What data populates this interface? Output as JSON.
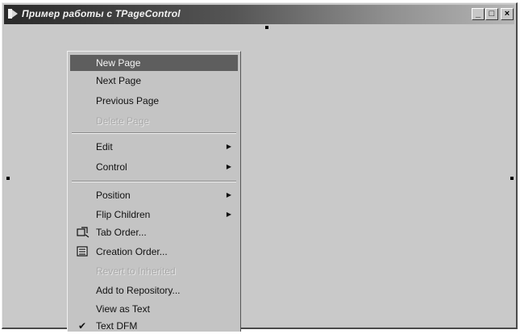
{
  "window": {
    "title": "Пример работы с TPageControl",
    "min_symbol": "_",
    "max_symbol": "□",
    "close_symbol": "×"
  },
  "menu": {
    "items": [
      {
        "label": "New Page",
        "state": "highlighted"
      },
      {
        "label": "Next Page",
        "state": "normal"
      },
      {
        "label": "Previous Page",
        "state": "normal"
      },
      {
        "label": "Delete Page",
        "state": "disabled"
      },
      {
        "label": "Edit",
        "state": "normal",
        "submenu": true
      },
      {
        "label": "Control",
        "state": "normal",
        "submenu": true
      },
      {
        "label": "Position",
        "state": "normal",
        "submenu": true
      },
      {
        "label": "Flip Children",
        "state": "normal",
        "submenu": true
      },
      {
        "label": "Tab Order...",
        "state": "normal",
        "icon": "tab-order-icon"
      },
      {
        "label": "Creation Order...",
        "state": "normal",
        "icon": "creation-order-icon"
      },
      {
        "label": "Revert to Inherited",
        "state": "disabled"
      },
      {
        "label": "Add to Repository...",
        "state": "normal"
      },
      {
        "label": "View as Text",
        "state": "normal"
      },
      {
        "label": "Text DFM",
        "state": "checked"
      }
    ],
    "submenu_arrow": "▶",
    "check_mark": "✔"
  }
}
